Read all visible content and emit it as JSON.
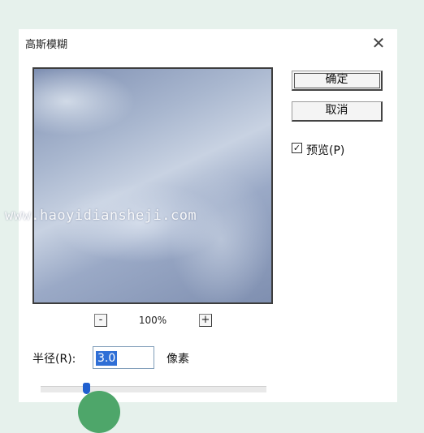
{
  "dialog": {
    "title": "高斯模糊",
    "close_symbol": "✕"
  },
  "buttons": {
    "ok_label": "确定",
    "cancel_label": "取消"
  },
  "preview_option": {
    "label": "预览(P)",
    "checked": true,
    "check_symbol": "✓"
  },
  "zoom": {
    "minus_label": "-",
    "plus_label": "+",
    "level": "100%"
  },
  "radius": {
    "label": "半径(R):",
    "value": "3.0",
    "unit": "像素"
  },
  "watermark": {
    "text": "www.haoyidiansheji.com"
  }
}
